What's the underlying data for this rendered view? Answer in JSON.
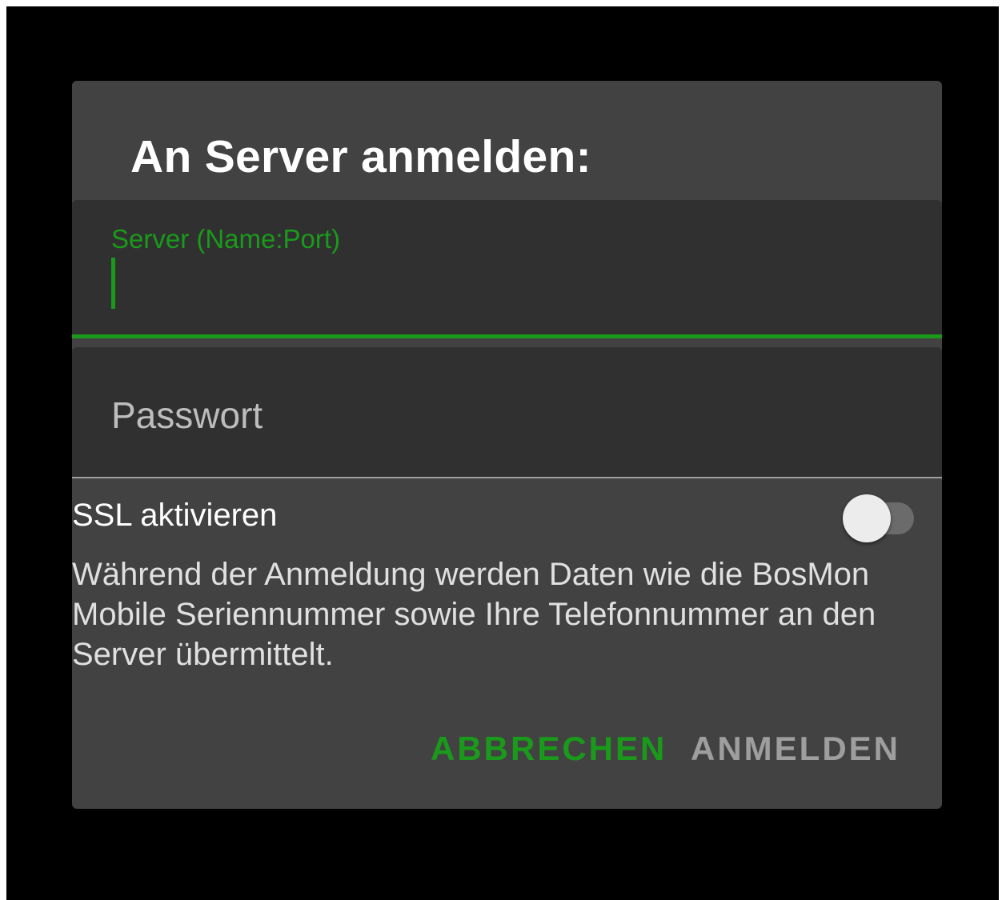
{
  "dialog": {
    "title": "An Server anmelden:",
    "server_field": {
      "label": "Server (Name:Port)",
      "value": ""
    },
    "password_field": {
      "placeholder": "Passwort",
      "value": ""
    },
    "ssl": {
      "label": "SSL aktivieren",
      "enabled": false
    },
    "info": "Während der Anmeldung werden Daten wie die BosMon Mobile Seriennummer sowie Ihre Telefonnummer an den Server übermittelt.",
    "buttons": {
      "cancel": "ABBRECHEN",
      "login": "ANMELDEN"
    }
  },
  "colors": {
    "accent": "#1a9a1a",
    "dialog_bg": "#424242",
    "field_bg": "#303030",
    "background": "#000000"
  }
}
